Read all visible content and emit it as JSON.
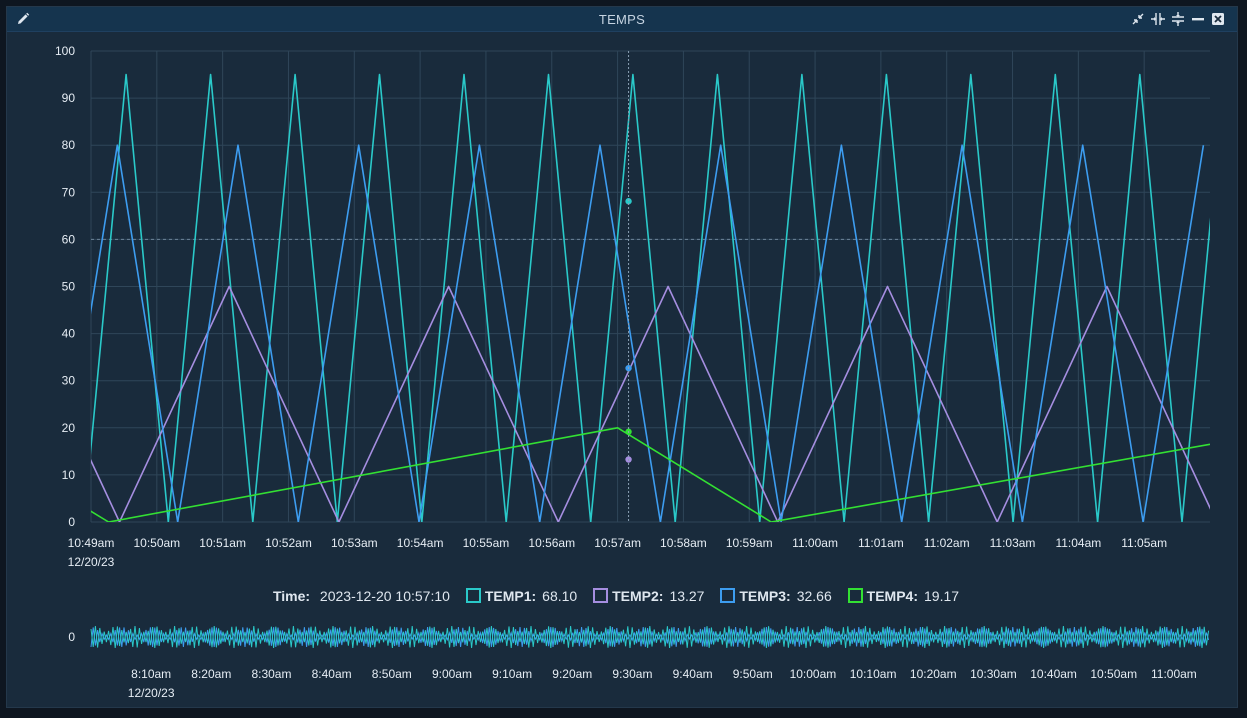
{
  "panel": {
    "title": "TEMPS"
  },
  "icons": {
    "edit": "pencil-icon",
    "shrink": "shrink-icon",
    "split_h": "split-horizontal-icon",
    "split_v": "split-vertical-icon",
    "minimize": "minimize-icon",
    "close": "close-icon"
  },
  "legend": {
    "time_label": "Time:",
    "time_value": "2023-12-20 10:57:10",
    "items": [
      {
        "name": "TEMP1:",
        "value": "68.10",
        "color": "#2ac9c9"
      },
      {
        "name": "TEMP2:",
        "value": "13.27",
        "color": "#a58ee0"
      },
      {
        "name": "TEMP3:",
        "value": "32.66",
        "color": "#3d9df0"
      },
      {
        "name": "TEMP4:",
        "value": "19.17",
        "color": "#33e033"
      }
    ]
  },
  "chart_data": [
    {
      "type": "line",
      "ylim": [
        0,
        100
      ],
      "yticks": [
        "0",
        "10",
        "20",
        "30",
        "40",
        "50",
        "60",
        "70",
        "80",
        "90",
        "100"
      ],
      "xlim": [
        "10:49:00",
        "11:06:00"
      ],
      "xticks": [
        "10:49am",
        "10:50am",
        "10:51am",
        "10:52am",
        "10:53am",
        "10:54am",
        "10:55am",
        "10:56am",
        "10:57am",
        "10:58am",
        "10:59am",
        "11:00am",
        "11:01am",
        "11:02am",
        "11:03am",
        "11:04am",
        "11:05am"
      ],
      "date_label": "12/20/23",
      "grid": true,
      "cursor_time": "10:57:10",
      "reference_line_y": 60,
      "series": [
        {
          "name": "TEMP1",
          "color": "#2ac9c9",
          "min": 0,
          "max": 95,
          "period_seconds": 77,
          "peak_times": [
            "10:49:32",
            "10:50:49",
            "10:52:06",
            "10:53:23",
            "10:54:40",
            "10:55:57",
            "10:57:14",
            "10:58:31",
            "10:59:48",
            "11:01:05",
            "11:02:22",
            "11:03:39",
            "11:04:56"
          ],
          "cursor_value": 68.1
        },
        {
          "name": "TEMP2",
          "color": "#a58ee0",
          "min": 0,
          "max": 50,
          "period_seconds": 200,
          "peak_times": [
            "10:51:06",
            "10:54:26",
            "10:57:46",
            "11:01:06",
            "11:04:26"
          ],
          "cursor_value": 13.27
        },
        {
          "name": "TEMP3",
          "color": "#3d9df0",
          "min": 0,
          "max": 80,
          "period_seconds": 110,
          "peak_times": [
            "10:49:24",
            "10:51:14",
            "10:53:04",
            "10:54:54",
            "10:56:44",
            "10:58:34",
            "11:00:24",
            "11:02:14",
            "11:04:04"
          ],
          "cursor_value": 32.66
        },
        {
          "name": "TEMP4",
          "color": "#33e033",
          "points": [
            [
              "10:48:55",
              3
            ],
            [
              "10:49:16",
              0
            ],
            [
              "10:57:00",
              20
            ],
            [
              "10:59:20",
              0
            ],
            [
              "11:06:00",
              16.5
            ]
          ],
          "cursor_value": 19.17
        }
      ]
    },
    {
      "type": "line",
      "role": "overview",
      "yticks": [
        "0"
      ],
      "xticks": [
        "8:10am",
        "8:20am",
        "8:30am",
        "8:40am",
        "8:50am",
        "9:00am",
        "9:10am",
        "9:20am",
        "9:30am",
        "9:40am",
        "9:50am",
        "10:00am",
        "10:10am",
        "10:20am",
        "10:30am",
        "10:40am",
        "10:50am",
        "11:00am"
      ],
      "date_label": "12/20/23"
    }
  ]
}
